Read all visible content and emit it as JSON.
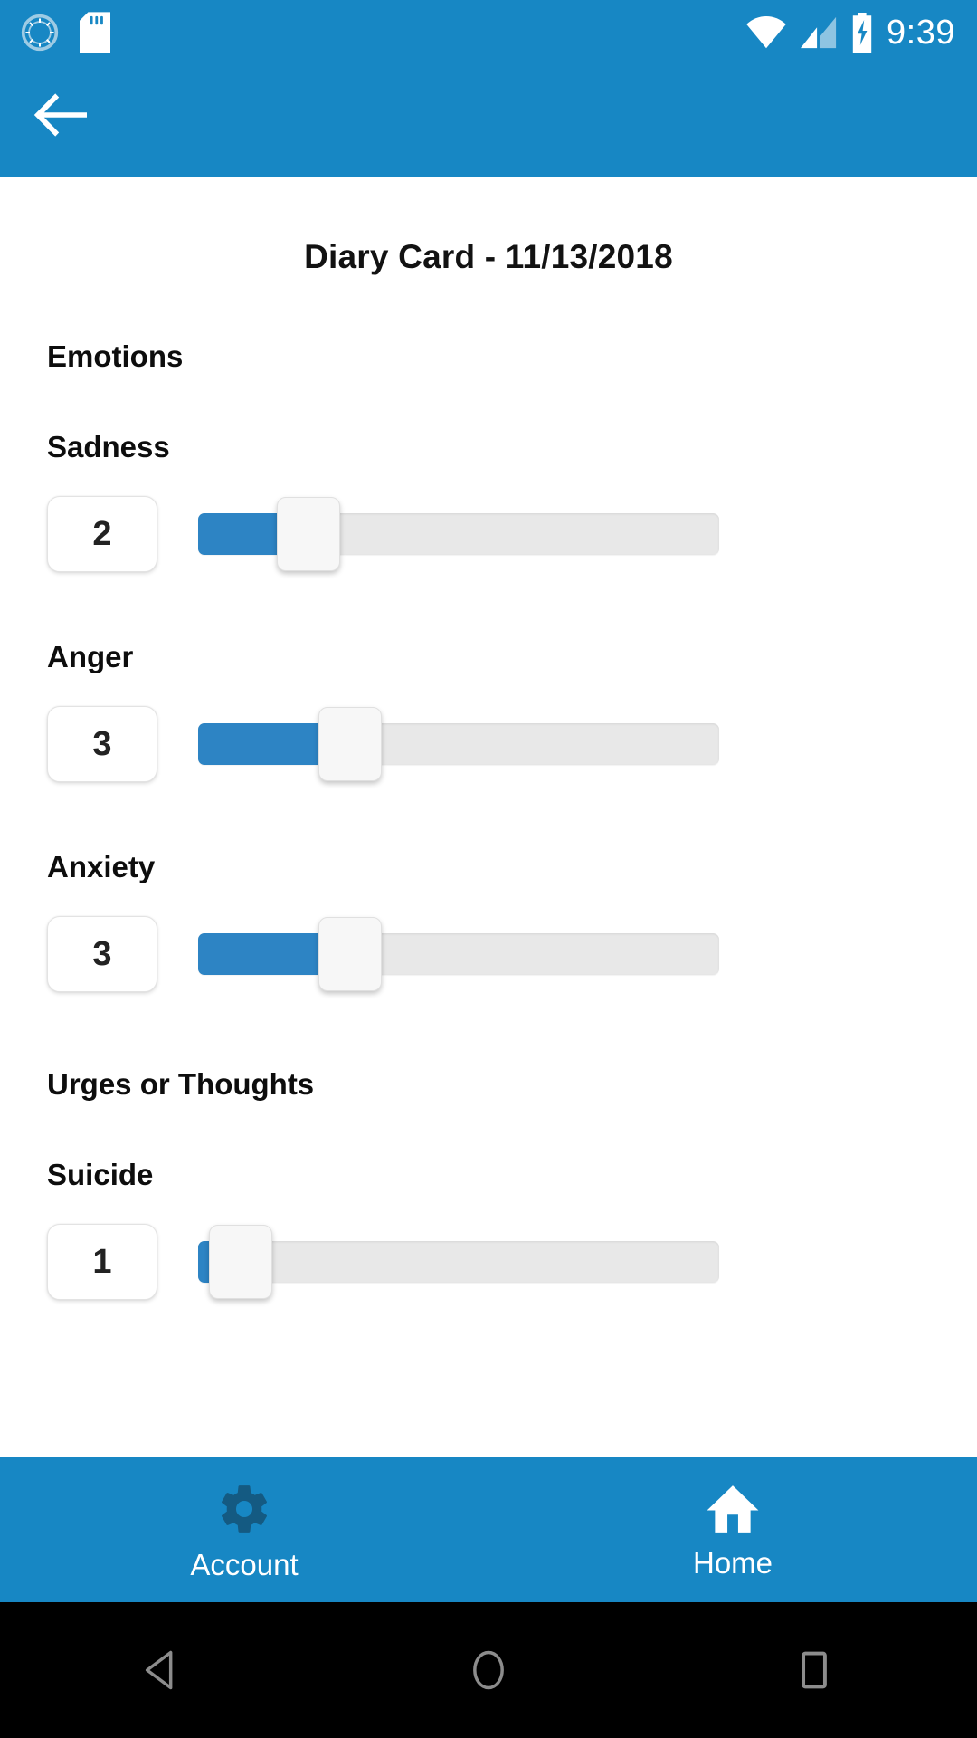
{
  "status_bar": {
    "time": "9:39",
    "icons": [
      "alarm-icon",
      "sd-card-icon",
      "wifi-icon",
      "cellular-signal-icon",
      "battery-charging-icon"
    ]
  },
  "app_bar": {
    "back_icon": "back-arrow-icon",
    "background_color": "#1787c4"
  },
  "main": {
    "title": "Diary Card - 11/13/2018",
    "sections": [
      {
        "heading": "Emotions",
        "items": [
          {
            "label": "Sadness",
            "value": "2",
            "percent": 18
          },
          {
            "label": "Anger",
            "value": "3",
            "percent": 26
          },
          {
            "label": "Anxiety",
            "value": "3",
            "percent": 26
          }
        ]
      },
      {
        "heading": "Urges or Thoughts",
        "items": [
          {
            "label": "Suicide",
            "value": "1",
            "percent": 5
          }
        ]
      }
    ]
  },
  "tab_bar": {
    "background_color": "#1787c4",
    "tabs": [
      {
        "label": "Account",
        "icon": "gear-icon",
        "icon_color": "#145a82"
      },
      {
        "label": "Home",
        "icon": "home-icon",
        "icon_color": "#ffffff"
      }
    ]
  },
  "system_nav": {
    "buttons": [
      {
        "name": "back-triangle-icon"
      },
      {
        "name": "home-circle-icon"
      },
      {
        "name": "recents-square-icon"
      }
    ]
  },
  "colors": {
    "accent_blue": "#1787c4",
    "slider_fill": "#2d84c4",
    "track_gray": "#e8e8e8"
  }
}
